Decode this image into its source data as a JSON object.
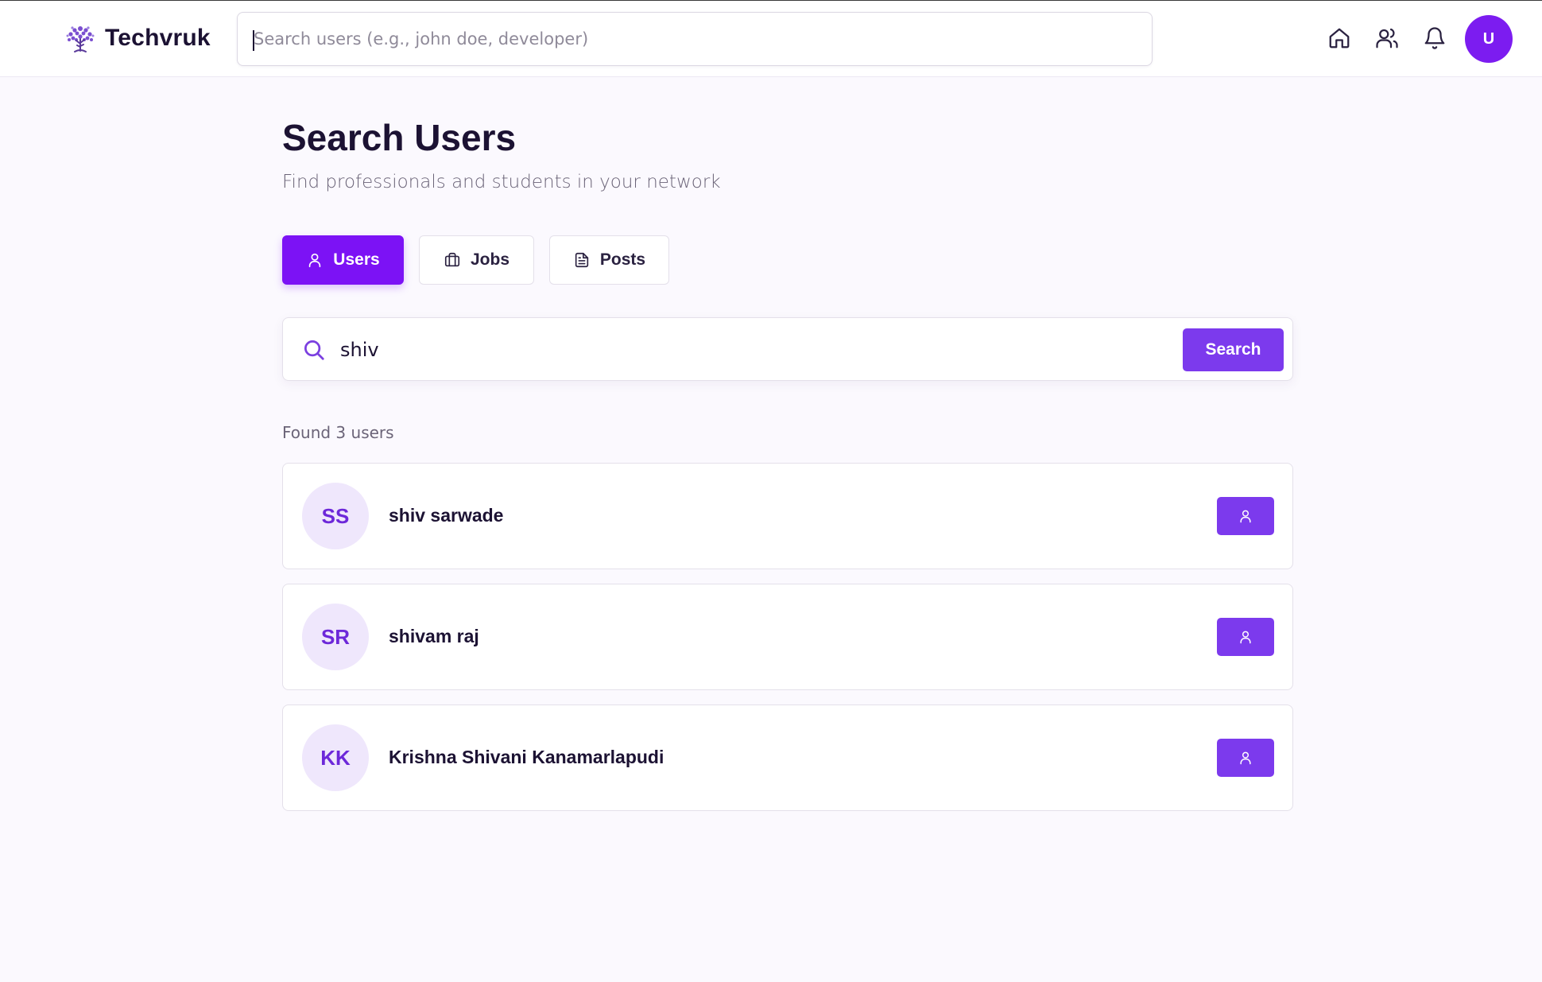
{
  "app": {
    "name": "Techvruk"
  },
  "header": {
    "search_placeholder": "Search users (e.g., john doe, developer)",
    "search_value": "",
    "nav_icons": [
      "home-icon",
      "users-icon",
      "bell-icon"
    ],
    "user_avatar_initial": "U"
  },
  "page": {
    "title": "Search Users",
    "subtitle": "Find professionals and students in your network"
  },
  "tabs": [
    {
      "label": "Users",
      "icon": "user-icon",
      "active": true
    },
    {
      "label": "Jobs",
      "icon": "briefcase-icon",
      "active": false
    },
    {
      "label": "Posts",
      "icon": "document-icon",
      "active": false
    }
  ],
  "search": {
    "value": "shiv",
    "button_label": "Search"
  },
  "results": {
    "count_text": "Found 3 users",
    "users": [
      {
        "initials": "SS",
        "name": "shiv sarwade"
      },
      {
        "initials": "SR",
        "name": "shivam raj"
      },
      {
        "initials": "KK",
        "name": "Krishna Shivani Kanamarlapudi"
      }
    ]
  },
  "colors": {
    "accent": "#7c12f5",
    "button": "#7c3aed",
    "avatar_bg": "#efe7fc",
    "avatar_text": "#6d28d9",
    "page_bg": "#fbf9fe"
  }
}
